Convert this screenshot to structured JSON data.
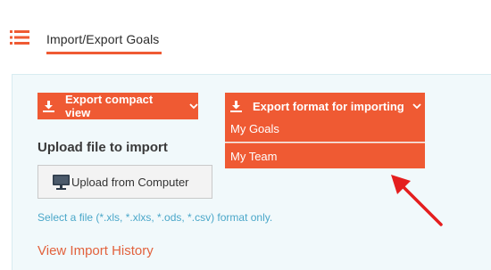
{
  "tabs": [
    {
      "label": "Import/Export Goals",
      "active": true
    }
  ],
  "export": {
    "compact_label": "Export compact view",
    "format_label": "Export format for importing",
    "format_options": [
      "My Goals",
      "My Team"
    ]
  },
  "upload": {
    "heading": "Upload file to import",
    "button_label": "Upload from Computer",
    "hint": "Select a file (*.xls, *.xlxs, *.ods, *.csv) format only."
  },
  "history_link": "View Import History",
  "icons": [
    "list-icon",
    "download-icon",
    "chevron-down-icon",
    "monitor-icon"
  ],
  "colors": {
    "accent": "#ef5a33",
    "panel_bg": "#f1f9fb",
    "hint_text": "#4aa7c9",
    "annotation_arrow": "#e41e1e"
  }
}
